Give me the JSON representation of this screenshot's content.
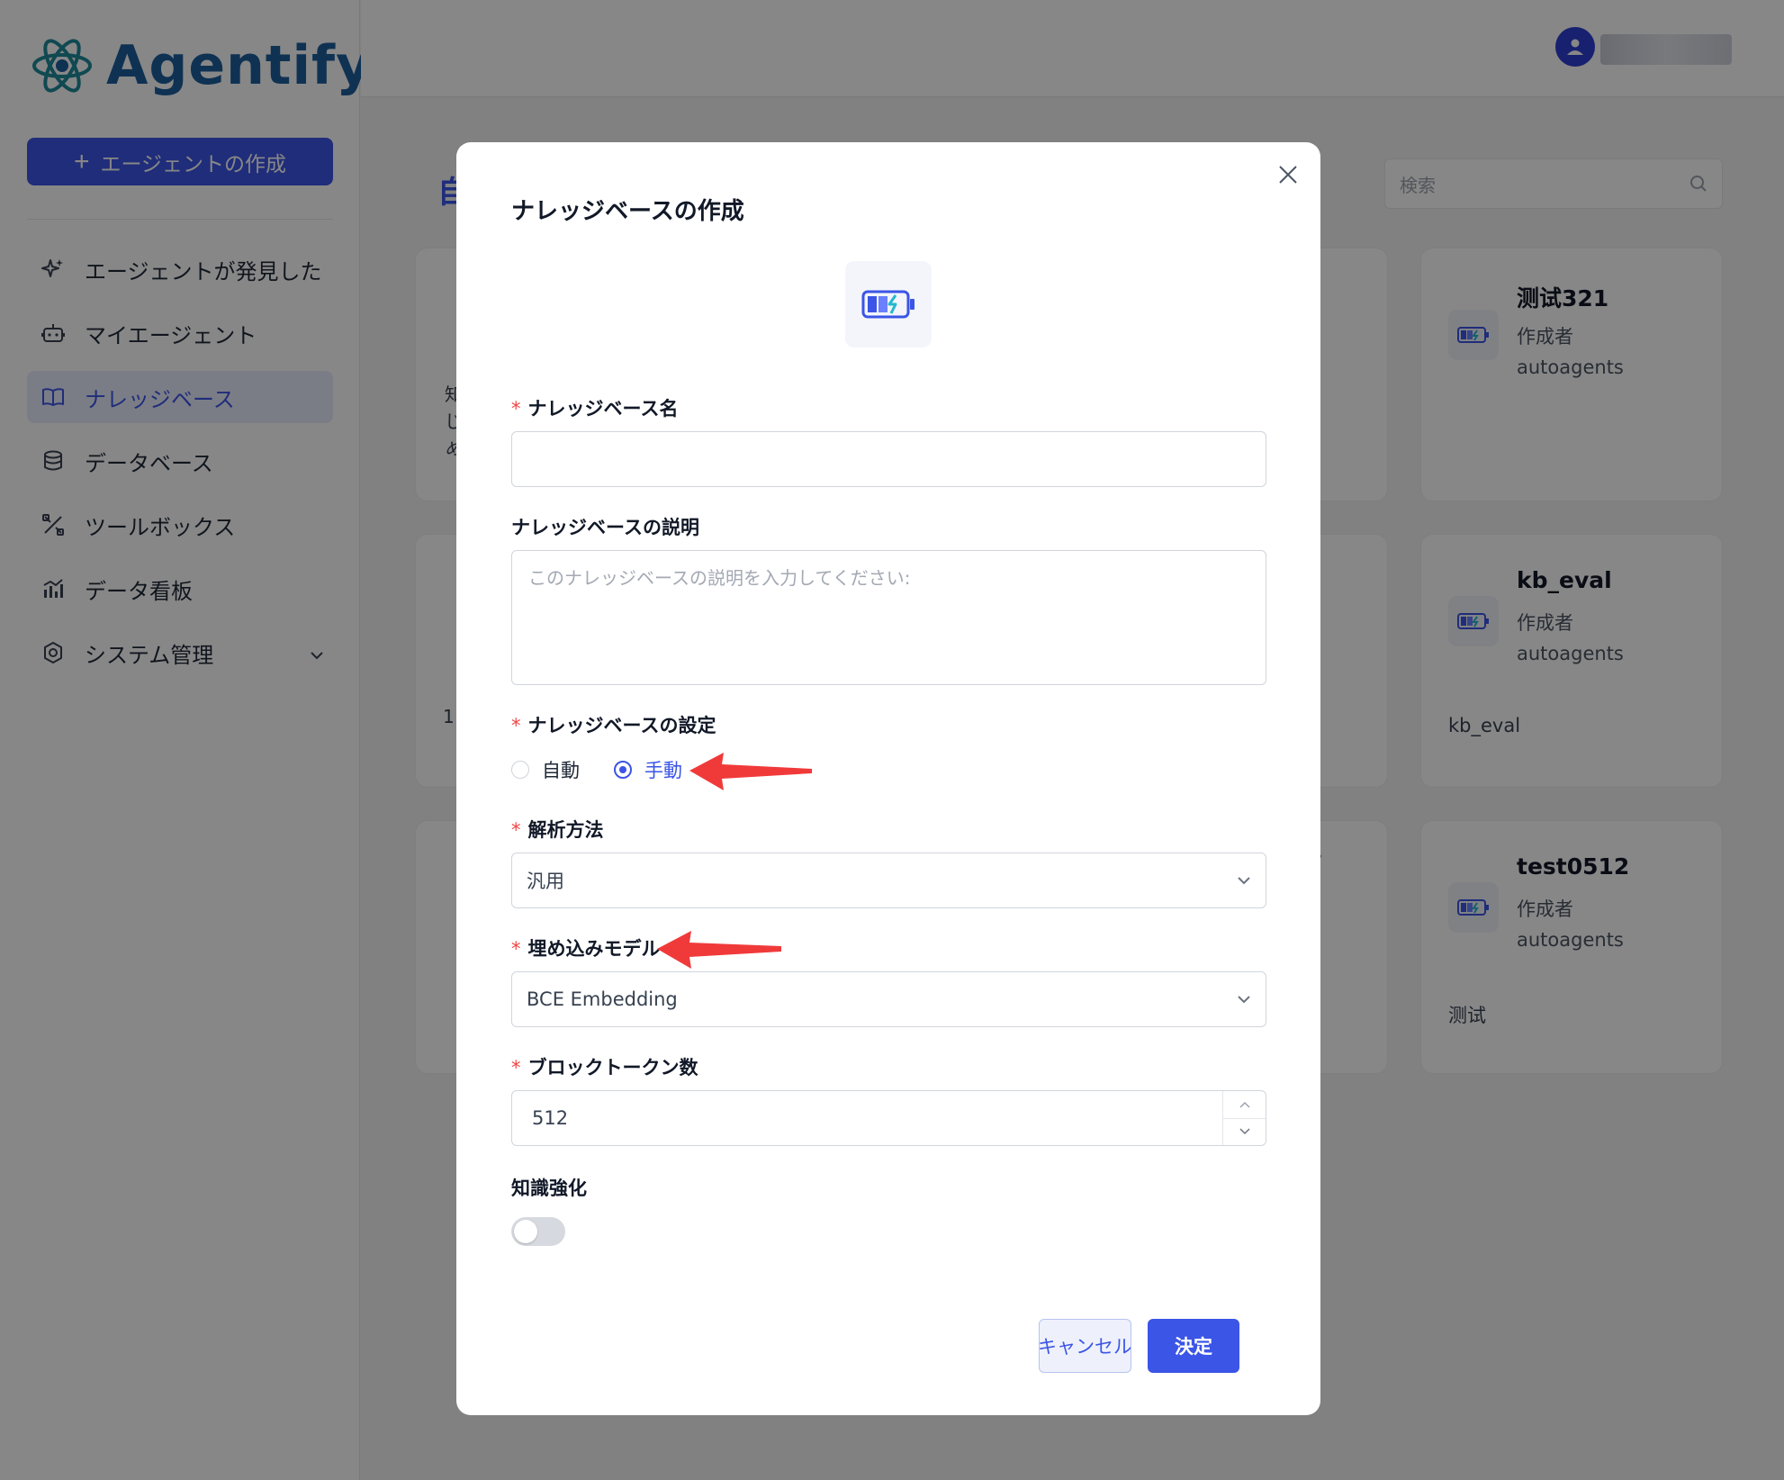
{
  "app": {
    "brand": "Agentify",
    "create_agent_label": "エージェントの作成",
    "nav": [
      {
        "label": "エージェントが発見した",
        "icon": "sparkle-icon"
      },
      {
        "label": "マイエージェント",
        "icon": "robot-icon"
      },
      {
        "label": "ナレッジベース",
        "icon": "book-icon",
        "active": true
      },
      {
        "label": "データベース",
        "icon": "database-icon"
      },
      {
        "label": "ツールボックス",
        "icon": "tools-icon"
      },
      {
        "label": "データ看板",
        "icon": "chart-icon"
      },
      {
        "label": "システム管理",
        "icon": "settings-icon"
      }
    ],
    "search_placeholder": "検索",
    "page_title_fragment": "自",
    "cards": [
      {
        "name": "测试321",
        "by_label": "作成者",
        "author": "autoagents",
        "description": ""
      },
      {
        "name": "kb_eval",
        "by_label": "作成者",
        "author": "autoagents",
        "description": "kb_eval"
      },
      {
        "name": "test0512",
        "by_label": "作成者",
        "author": "autoagents",
        "description": "测试"
      }
    ],
    "partial_texts": {
      "left_col_1": "知",
      "left_col_2": "じ",
      "left_col_3": "め",
      "left_count": "1",
      "dots": "·"
    }
  },
  "modal": {
    "title": "ナレッジベースの作成",
    "fields": {
      "name_label": "ナレッジベース名",
      "name_value": "",
      "description_label": "ナレッジベースの説明",
      "description_placeholder": "このナレッジベースの説明を入力してください:",
      "settings_label": "ナレッジベースの設定",
      "settings_options": [
        "自動",
        "手動"
      ],
      "settings_selected": "手動",
      "parse_label": "解析方法",
      "parse_value": "汎用",
      "embedding_label": "埋め込みモデル",
      "embedding_value": "BCE Embedding",
      "block_tokens_label": "ブロックトークン数",
      "block_tokens_value": "512",
      "knowledge_enhance_label": "知識強化",
      "knowledge_enhance_on": false
    },
    "buttons": {
      "cancel": "キャンセル",
      "ok": "決定"
    }
  },
  "colors": {
    "primary": "#3b55e6",
    "brand": "#1e5f9e",
    "required": "#ef4444",
    "annotation_arrow": "#f03a3a"
  }
}
